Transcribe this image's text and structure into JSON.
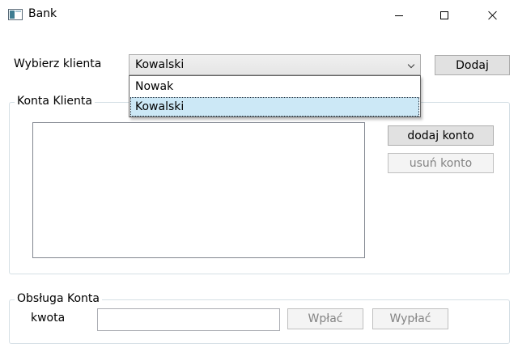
{
  "window": {
    "title": "Bank",
    "icon": "app-window-icon",
    "controls": [
      "minimize-icon",
      "maximize-icon",
      "close-icon"
    ]
  },
  "client_selector": {
    "label": "Wybierz klienta",
    "selected": "Kowalski",
    "options": [
      "Nowak",
      "Kowalski"
    ],
    "highlighted_index": 1,
    "add_button": "Dodaj"
  },
  "accounts_group": {
    "title": "Konta Klienta",
    "accounts": [],
    "add_account_button": "dodaj konto",
    "remove_account_button": "usuń konto"
  },
  "operations_group": {
    "title": "Obsługa Konta",
    "amount_label": "kwota",
    "amount_value": "",
    "deposit_button": "Wpłać",
    "withdraw_button": "Wypłać"
  },
  "colors": {
    "selection_highlight": "#cce8f6",
    "button_face": "#e1e1e1",
    "disabled_text": "#838383"
  }
}
